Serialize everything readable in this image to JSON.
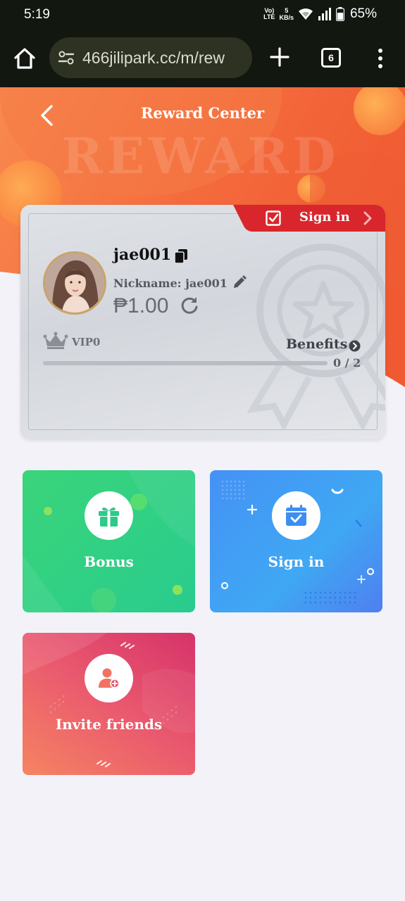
{
  "status_bar": {
    "time": "5:19",
    "volte": "VoLTE",
    "net_speed_value": "5",
    "net_speed_unit": "KB/s",
    "battery": "65%"
  },
  "browser": {
    "url": "466jilipark.cc/m/rew",
    "tab_count": "6"
  },
  "header": {
    "title": "Reward Center"
  },
  "user_card": {
    "sign_in_label": "Sign in",
    "username": "jae001",
    "nickname": "Nickname: jae001",
    "balance": "₱1.00",
    "vip_level": "VIP0",
    "benefits_label": "Benefits",
    "progress_text": "0 / 2",
    "progress_fraction": 0
  },
  "tiles": {
    "bonus": "Bonus",
    "sign_in": "Sign in",
    "invite": "Invite friends"
  },
  "colors": {
    "hero_orange": "#f46a3c",
    "ribbon_red": "#d8262c",
    "bonus_green": "#35d17f",
    "signin_blue": "#4591f5",
    "invite_pink": "#ea5a6e"
  }
}
